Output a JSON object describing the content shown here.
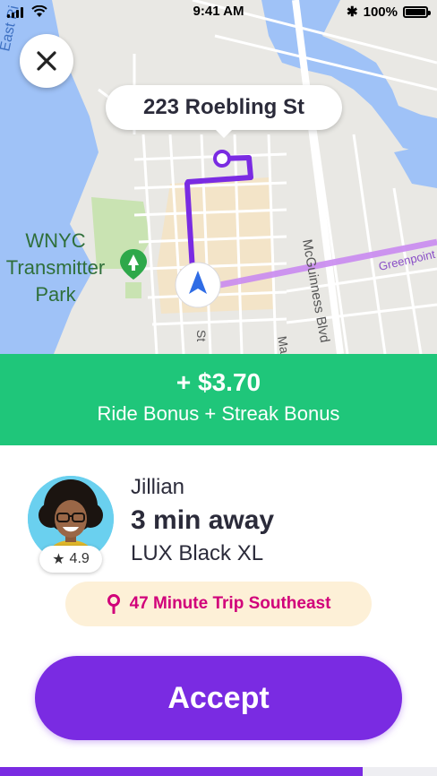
{
  "status_bar": {
    "time": "9:41 AM",
    "battery": "100%",
    "icons": [
      "signal-icon",
      "wifi-icon",
      "bluetooth-icon",
      "battery-icon"
    ]
  },
  "map": {
    "destination": "223 Roebling St",
    "labels": {
      "river": "East Ri",
      "park_line1": "WNYC",
      "park_line2": "Transmitter",
      "park_line3": "Park",
      "street_1": "McGuinness Blvd",
      "street_2": "Greenpoint",
      "street_3": "St",
      "street_4": "Ma"
    },
    "colors": {
      "route": "#7a2be2",
      "water": "#9fc2f7",
      "park": "#c9e3b2",
      "land": "#e9e8e4"
    }
  },
  "close_button": {
    "icon": "close-icon"
  },
  "bonus": {
    "amount": "+ $3.70",
    "description": "Ride Bonus + Streak Bonus",
    "color": "#1fc67a"
  },
  "rider": {
    "name": "Jillian",
    "rating": "4.9",
    "eta": "3 min away",
    "vehicle": "LUX Black XL"
  },
  "trip": {
    "label": "47 Minute Trip Southeast",
    "icon": "map-pin-icon",
    "color": "#d1007a"
  },
  "actions": {
    "accept_label": "Accept",
    "accent": "#7a2be2"
  },
  "progress": {
    "value": 0.83
  }
}
